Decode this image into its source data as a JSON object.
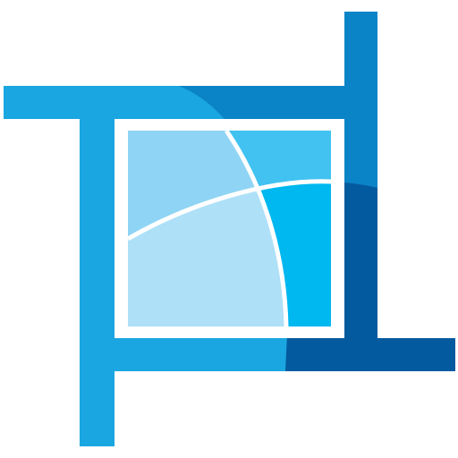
{
  "icon": {
    "name": "crop-tool-icon",
    "colors": {
      "background": "#ffffff",
      "frame_light": "#1aa6e0",
      "frame_mid": "#0a84c7",
      "frame_dark": "#045a9e",
      "pane_pale": "#aee0f8",
      "pane_light": "#8fd4f4",
      "pane_bright": "#41c2f0",
      "pane_cyan": "#00b8f0",
      "grid_line": "#ffffff"
    }
  }
}
